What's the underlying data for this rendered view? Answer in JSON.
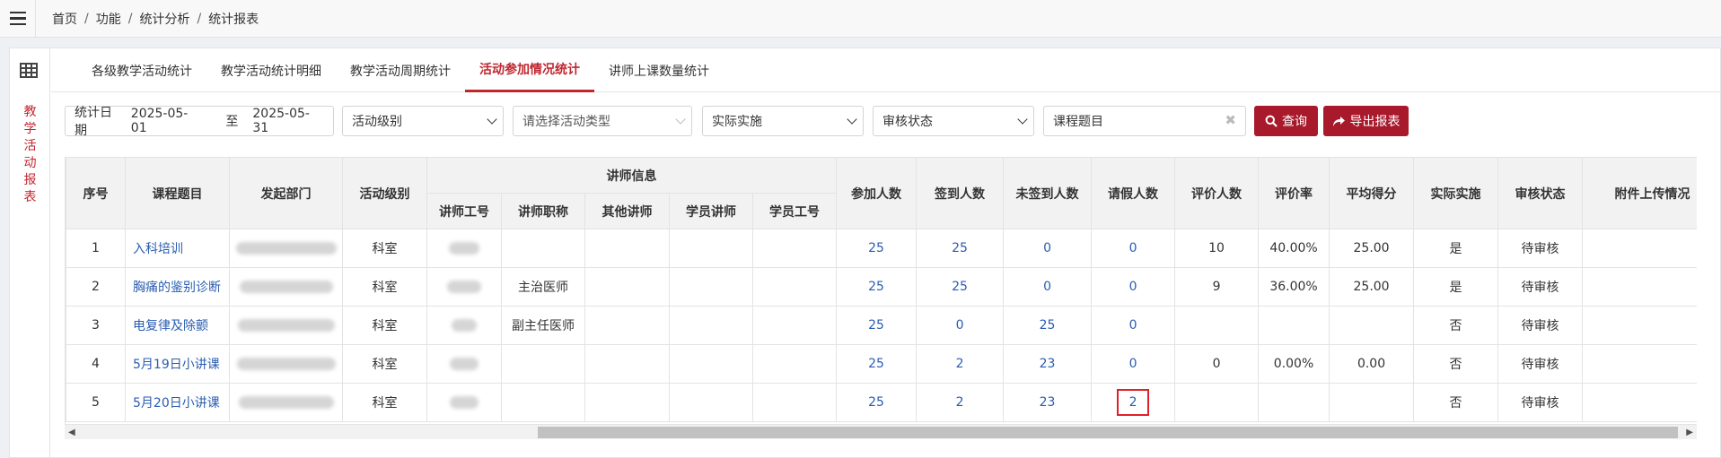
{
  "breadcrumb": [
    "首页",
    "功能",
    "统计分析",
    "统计报表"
  ],
  "side_title": [
    "教",
    "学",
    "活",
    "动",
    "报",
    "表"
  ],
  "tabs": [
    "各级教学活动统计",
    "教学活动统计明细",
    "教学活动周期统计",
    "活动参加情况统计",
    "讲师上课数量统计"
  ],
  "active_tab": 3,
  "filters": {
    "date_label": "统计日期",
    "date_start": "2025-05-01",
    "date_to": "至",
    "date_end": "2025-05-31",
    "level": "活动级别",
    "type": "请选择活动类型",
    "actual": "实际实施",
    "audit": "审核状态",
    "course_placeholder": "课程题目"
  },
  "buttons": {
    "query": "查询",
    "export": "导出报表"
  },
  "table": {
    "headers": {
      "seq": "序号",
      "course": "课程题目",
      "dept": "发起部门",
      "level": "活动级别",
      "lecturer_info": "讲师信息",
      "lecturer_id": "讲师工号",
      "lecturer_title": "讲师职称",
      "other": "其他讲师",
      "student_lecturer": "学员讲师",
      "student_id": "学员工号",
      "participants": "参加人数",
      "signed": "签到人数",
      "unsigned": "未签到人数",
      "leave": "请假人数",
      "evaluators": "评价人数",
      "eval_rate": "评价率",
      "avg_score": "平均得分",
      "actual": "实际实施",
      "audit": "审核状态",
      "attach": "附件上传情况"
    },
    "rows": [
      {
        "seq": "1",
        "course": "入科培训",
        "level": "科室",
        "title": "",
        "participants": "25",
        "signed": "25",
        "unsigned": "0",
        "leave": "0",
        "evaluators": "10",
        "eval_rate": "40.00%",
        "avg_score": "25.00",
        "actual": "是",
        "audit": "待审核"
      },
      {
        "seq": "2",
        "course": "胸痛的鉴别诊断",
        "level": "科室",
        "title": "主治医师",
        "participants": "25",
        "signed": "25",
        "unsigned": "0",
        "leave": "0",
        "evaluators": "9",
        "eval_rate": "36.00%",
        "avg_score": "25.00",
        "actual": "是",
        "audit": "待审核"
      },
      {
        "seq": "3",
        "course": "电复律及除颤",
        "level": "科室",
        "title": "副主任医师",
        "participants": "25",
        "signed": "0",
        "unsigned": "25",
        "leave": "0",
        "evaluators": "",
        "eval_rate": "",
        "avg_score": "",
        "actual": "否",
        "audit": "待审核"
      },
      {
        "seq": "4",
        "course": "5月19日小讲课",
        "level": "科室",
        "title": "",
        "participants": "25",
        "signed": "2",
        "unsigned": "23",
        "leave": "0",
        "evaluators": "0",
        "eval_rate": "0.00%",
        "avg_score": "0.00",
        "actual": "否",
        "audit": "待审核"
      },
      {
        "seq": "5",
        "course": "5月20日小讲课",
        "level": "科室",
        "title": "",
        "participants": "25",
        "signed": "2",
        "unsigned": "23",
        "leave": "2",
        "evaluators": "",
        "eval_rate": "",
        "avg_score": "",
        "actual": "否",
        "audit": "待审核"
      }
    ],
    "highlighted_cell": {
      "row": 4,
      "column": "leave"
    }
  },
  "colors": {
    "accent": "#c0262f",
    "button": "#a7192b",
    "link": "#2a5db0",
    "highlight": "#e01f28"
  }
}
